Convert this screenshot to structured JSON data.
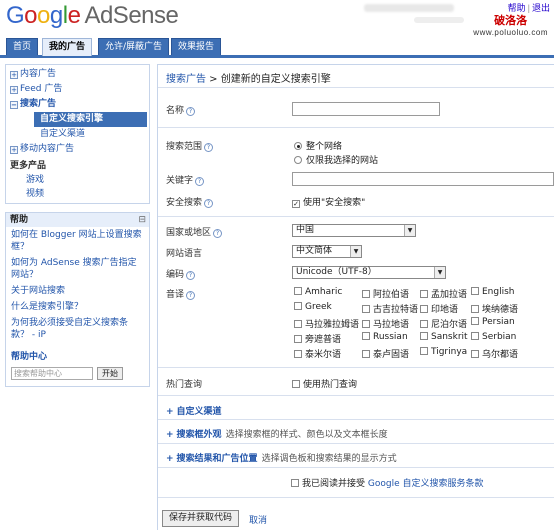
{
  "header": {
    "logo_google": "Google",
    "logo_product": "AdSense",
    "toplinks": [
      "帮助",
      "|",
      "退出"
    ],
    "watermark_title": "破洛洛",
    "watermark_url": "www.poluoluo.com"
  },
  "tabs": [
    "首页",
    "我的广告",
    "允许/屏蔽广告",
    "效果报告"
  ],
  "sidebar": {
    "nav": [
      {
        "label": "内容广告",
        "marker": "+"
      },
      {
        "label": "Feed 广告",
        "marker": "+"
      },
      {
        "label": "搜索广告",
        "marker": "−"
      }
    ],
    "sub_items": [
      "自定义搜索引擎",
      "自定义渠道"
    ],
    "nav_mobile": {
      "label": "移动内容广告",
      "marker": "+"
    },
    "more_title": "更多产品",
    "more_items": [
      "游戏",
      "视频"
    ],
    "help": {
      "title": "帮助",
      "minimize": "⊟",
      "links": [
        "如何在 Blogger 网站上设置搜索框？",
        "如何为 AdSense 搜索广告指定网站？",
        "关于网站搜索",
        "什么是搜索引擎？",
        "为何我必须接受自定义搜索条款？ - iP"
      ],
      "center": "帮助中心",
      "search_placeholder": "搜索帮助中心",
      "search_button": "开始"
    }
  },
  "main": {
    "crumb_link": "搜索广告",
    "crumb_rest": " > 创建新的自定义搜索引擎",
    "name_label": "名称",
    "scope_label": "搜索范围",
    "scope_options": [
      "整个网络",
      "仅限我选择的网站"
    ],
    "keywords_label": "关键字",
    "safesearch_label": "安全搜索",
    "safesearch_option": "使用\"安全搜索\"",
    "country_label": "国家或地区",
    "country_value": "中国",
    "site_lang_label": "网站语言",
    "site_lang_value": "中文简体",
    "encoding_label": "编码",
    "encoding_value": "Unicode（UTF-8）",
    "languages_label": "音译",
    "languages": [
      [
        "Amharic",
        "阿拉伯语",
        "孟加拉语",
        "English"
      ],
      [
        "Greek",
        "古吉拉特语",
        "印地语",
        "埃纳德语"
      ],
      [
        "马拉雅拉姆语",
        "马拉地语",
        "尼泊尔语",
        "Persian"
      ],
      [
        "旁遮普语",
        "Russian",
        "Sanskrit",
        "Serbian"
      ],
      [
        "泰米尔语",
        "泰卢固语",
        "Tigrinya",
        "乌尔都语"
      ]
    ],
    "popular_label": "热门查询",
    "popular_option": "使用热门查询",
    "sections": [
      {
        "marker": "+",
        "title": "自定义渠道",
        "desc": ""
      },
      {
        "marker": "+",
        "title": "搜索框外观",
        "desc": "选择搜索框的样式、颜色以及文本框长度"
      },
      {
        "marker": "+",
        "title": "搜索结果和广告位置",
        "desc": "选择调色板和搜索结果的显示方式"
      }
    ],
    "agree_text": "我已阅读并接受",
    "agree_link": "Google 自定义搜索服务条款",
    "save_button": "保存并获取代码",
    "cancel": "取消",
    "help_glyph": "?",
    "check_mark": "✓",
    "select_arrow": "▼"
  }
}
